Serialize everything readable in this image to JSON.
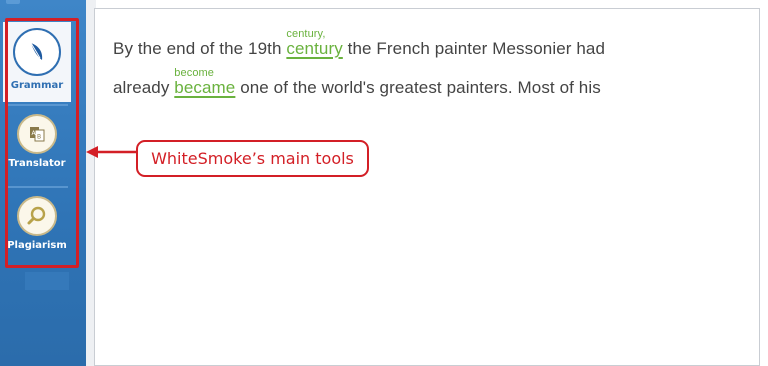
{
  "sidebar": {
    "tools": [
      {
        "label": "Grammar",
        "icon": "feather-pen-icon",
        "active": true
      },
      {
        "label": "Translator",
        "icon": "translate-document-icon",
        "active": false
      },
      {
        "label": "Plagiarism",
        "icon": "magnifier-icon",
        "active": false
      }
    ]
  },
  "document": {
    "line1": {
      "before": "By the end of the 19th ",
      "correction": "century",
      "suggestion": "century,",
      "after": " the French painter Messonier had"
    },
    "line2": {
      "before": "already ",
      "correction": "became",
      "suggestion": "become",
      "after": " one of the world's greatest painters. Most of his"
    }
  },
  "callout": {
    "text": "WhiteSmoke’s main tools"
  },
  "colors": {
    "sidebar_blue": "#2f74b6",
    "annotation_red": "#d31f26",
    "correction_green": "#6ab23e",
    "text_gray": "#444444"
  }
}
